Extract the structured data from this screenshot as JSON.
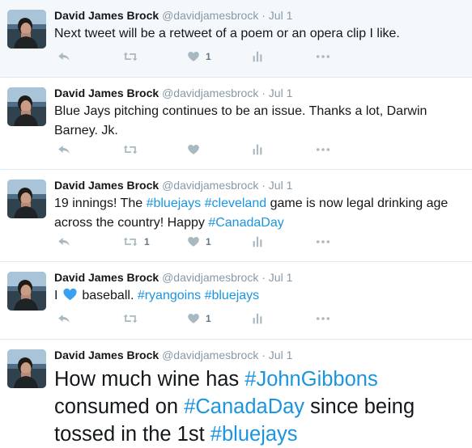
{
  "tweets": [
    {
      "name": "David James Brock",
      "handle": "@davidjamesbrock",
      "sep": "·",
      "date": "Jul 1",
      "text": "Next tweet will be a retweet of a poem or an opera clip I like.",
      "retweets": "",
      "likes": "1"
    },
    {
      "name": "David James Brock",
      "handle": "@davidjamesbrock",
      "sep": "·",
      "date": "Jul 1",
      "text": "Blue Jays pitching continues to be an issue. Thanks a lot, Darwin Barney. Jk.",
      "retweets": "",
      "likes": ""
    },
    {
      "name": "David James Brock",
      "handle": "@davidjamesbrock",
      "sep": "·",
      "date": "Jul 1",
      "parts": [
        "19 innings! The ",
        "#bluejays",
        " ",
        "#cleveland",
        " game is now legal drinking age across the country! Happy ",
        "#CanadaDay"
      ],
      "retweets": "1",
      "likes": "1"
    },
    {
      "name": "David James Brock",
      "handle": "@davidjamesbrock",
      "sep": "·",
      "date": "Jul 1",
      "parts": [
        "I ",
        " baseball. ",
        "#ryangoins",
        " ",
        "#bluejays"
      ],
      "emoji": "blue-heart-icon",
      "retweets": "",
      "likes": "1"
    },
    {
      "name": "David James Brock",
      "handle": "@davidjamesbrock",
      "sep": "·",
      "date": "Jul 1",
      "parts": [
        "How much wine has ",
        "#JohnGibbons",
        " consumed on ",
        "#CanadaDay",
        " since being tossed in the 1st ",
        "#bluejays"
      ]
    }
  ],
  "icons": {
    "reply": "reply-icon",
    "retweet": "retweet-icon",
    "like": "heart-icon",
    "analytics": "analytics-icon",
    "more": "more-icon"
  },
  "colors": {
    "link": "#1b95e0",
    "icon": "#aab8c2",
    "highlight_bg": "#f5f8fa",
    "divider": "#e1e8ed",
    "heart_emoji": "#3ba1ee"
  }
}
